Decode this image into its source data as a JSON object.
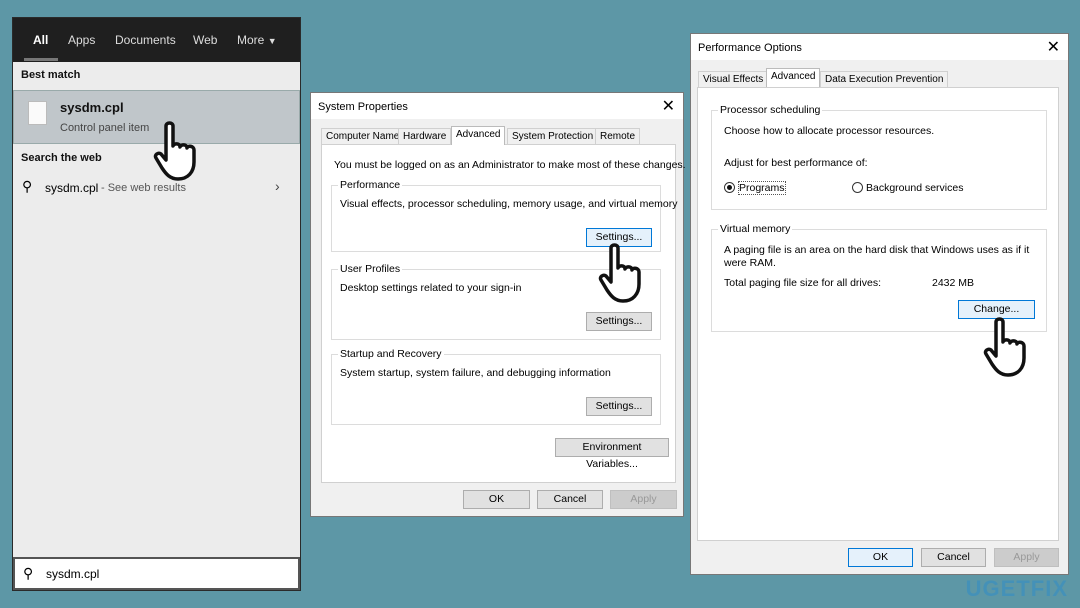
{
  "start_menu": {
    "tabs": [
      "All",
      "Apps",
      "Documents",
      "Web",
      "More"
    ],
    "best_match_label": "Best match",
    "best_match": {
      "title": "sysdm.cpl",
      "subtitle": "Control panel item"
    },
    "search_web_label": "Search the web",
    "web_result": {
      "query": "sysdm.cpl",
      "suffix": " - See web results"
    },
    "search_value": "sysdm.cpl"
  },
  "system_properties": {
    "title": "System Properties",
    "tabs": [
      "Computer Name",
      "Hardware",
      "Advanced",
      "System Protection",
      "Remote"
    ],
    "active_tab": "Advanced",
    "admin_note": "You must be logged on as an Administrator to make most of these changes.",
    "groups": [
      {
        "label": "Performance",
        "desc": "Visual effects, processor scheduling, memory usage, and virtual memory",
        "button": "Settings..."
      },
      {
        "label": "User Profiles",
        "desc": "Desktop settings related to your sign-in",
        "button": "Settings..."
      },
      {
        "label": "Startup and Recovery",
        "desc": "System startup, system failure, and debugging information",
        "button": "Settings..."
      }
    ],
    "env_button": "Environment Variables...",
    "ok": "OK",
    "cancel": "Cancel",
    "apply": "Apply"
  },
  "performance_options": {
    "title": "Performance Options",
    "tabs": [
      "Visual Effects",
      "Advanced",
      "Data Execution Prevention"
    ],
    "active_tab": "Advanced",
    "processor": {
      "label": "Processor scheduling",
      "desc": "Choose how to allocate processor resources.",
      "adjust": "Adjust for best performance of:",
      "options": [
        "Programs",
        "Background services"
      ],
      "selected": "Programs"
    },
    "virtual_memory": {
      "label": "Virtual memory",
      "desc1": "A paging file is an area on the hard disk that Windows uses as if it",
      "desc2": "were RAM.",
      "total_label": "Total paging file size for all drives:",
      "total_value": "2432 MB",
      "button": "Change..."
    },
    "ok": "OK",
    "cancel": "Cancel",
    "apply": "Apply"
  },
  "watermark": "UGETFIX"
}
